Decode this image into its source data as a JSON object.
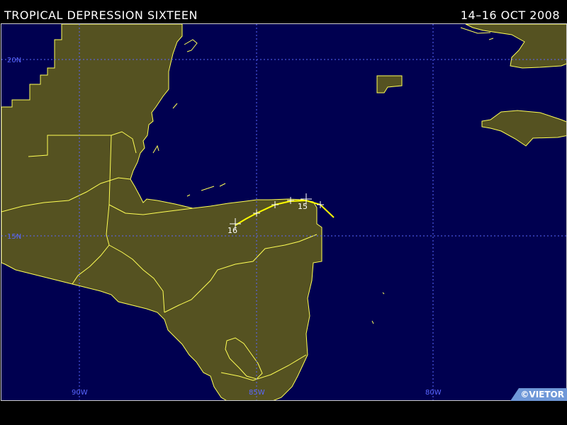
{
  "header": {
    "title": "TROPICAL DEPRESSION SIXTEEN",
    "dates": "14–16 OCT 2008"
  },
  "grid": {
    "lat_labels": [
      "20N",
      "15N"
    ],
    "lon_labels": [
      "90W",
      "85W",
      "80W"
    ]
  },
  "track": {
    "labels": [
      "15",
      "16"
    ],
    "color": "#ffff00"
  },
  "colors": {
    "ocean": "#000050",
    "land": "#555221",
    "coast": "#ffff55",
    "grid": "#5a67ff"
  },
  "credit": "©VIETOR"
}
